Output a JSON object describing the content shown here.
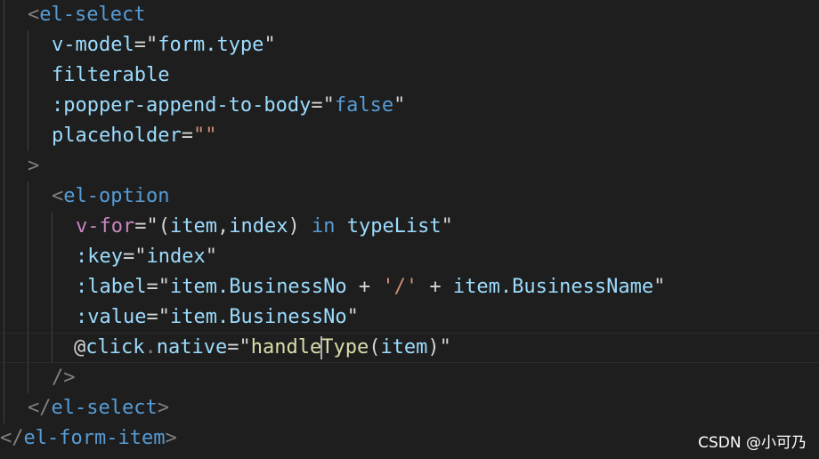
{
  "code": {
    "l1": {
      "open": "<",
      "tag": "el-select"
    },
    "l2": {
      "attr": "v-model",
      "eq": "=",
      "q1": "\"",
      "value": "form.type",
      "q2": "\""
    },
    "l3": {
      "attr": "filterable"
    },
    "l4": {
      "attr": ":popper-append-to-body",
      "eq": "=",
      "q1": "\"",
      "value": "false",
      "q2": "\""
    },
    "l5": {
      "attr": "placeholder",
      "eq": "=",
      "value": "\"\""
    },
    "l6": {
      "chevron": ">"
    },
    "l7": {
      "open": "<",
      "tag": "el-option"
    },
    "l8": {
      "attr": "v-for",
      "eq": "=",
      "q1": "\"",
      "p1": "(",
      "a": "item",
      "comma": ",",
      "b": "index",
      "p2": ")",
      "sp": " ",
      "kw": "in",
      "sp2": " ",
      "list": "typeList",
      "q2": "\""
    },
    "l9": {
      "attr": ":key",
      "eq": "=",
      "q1": "\"",
      "value": "index",
      "q2": "\""
    },
    "l10": {
      "attr": ":label",
      "eq": "=",
      "q1": "\"",
      "v1": "item.BusinessNo",
      "plus1": " + ",
      "str": "'/'",
      "plus2": " + ",
      "v2": "item.BusinessName",
      "q2": "\""
    },
    "l11": {
      "attr": ":value",
      "eq": "=",
      "q1": "\"",
      "value": "item.BusinessNo",
      "q2": "\""
    },
    "l12": {
      "at": "@",
      "attr": "click",
      "dot": ".",
      "mod": "native",
      "eq": "=",
      "q1": "\"",
      "fn1": "handle",
      "fn2": "Type",
      "p1": "(",
      "arg": "item",
      "p2": ")",
      "q2": "\""
    },
    "l13": {
      "close": "/>"
    },
    "l14": {
      "open": "</",
      "tag": "el-select",
      "close": ">"
    },
    "l15": {
      "open": "</",
      "tag": "el-form-item",
      "close": ">"
    }
  },
  "watermark": "CSDN @小可乃"
}
